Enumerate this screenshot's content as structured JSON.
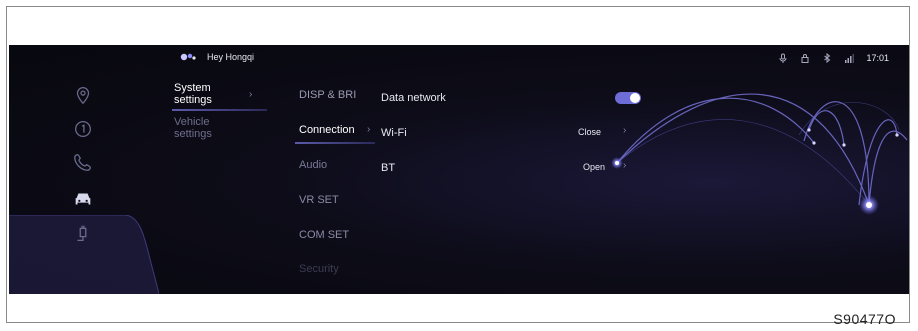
{
  "assistant": {
    "label": "Hey Hongqi"
  },
  "status_bar": {
    "icons": [
      "mic-icon",
      "lock-icon",
      "bluetooth-icon",
      "signal-icon"
    ],
    "time": "17:01"
  },
  "sidebar": {
    "icons": [
      "navigation-icon",
      "media-icon",
      "phone-icon",
      "car-icon",
      "charging-icon"
    ],
    "active_index": 3
  },
  "menu": {
    "level1": [
      {
        "label_line1": "System",
        "label_line2": "settings",
        "selected": true
      },
      {
        "label_line1": "Vehicle",
        "label_line2": "settings",
        "selected": false
      }
    ],
    "level2": [
      {
        "label": "DISP & BRI"
      },
      {
        "label": "Connection",
        "selected": true
      },
      {
        "label": "Audio"
      },
      {
        "label": "VR SET"
      },
      {
        "label": "COM SET"
      },
      {
        "label": "Security"
      }
    ]
  },
  "settings": {
    "data_network": {
      "label": "Data network",
      "enabled": true
    },
    "wifi": {
      "label": "Wi-Fi",
      "value": "Close"
    },
    "bt": {
      "label": "BT",
      "value": "Open"
    }
  },
  "colors": {
    "accent": "#6e6cd6",
    "background": "#0b0b13",
    "text": "#e8e8f2",
    "muted": "#6a6a8c"
  },
  "figure_code": "S90477O"
}
